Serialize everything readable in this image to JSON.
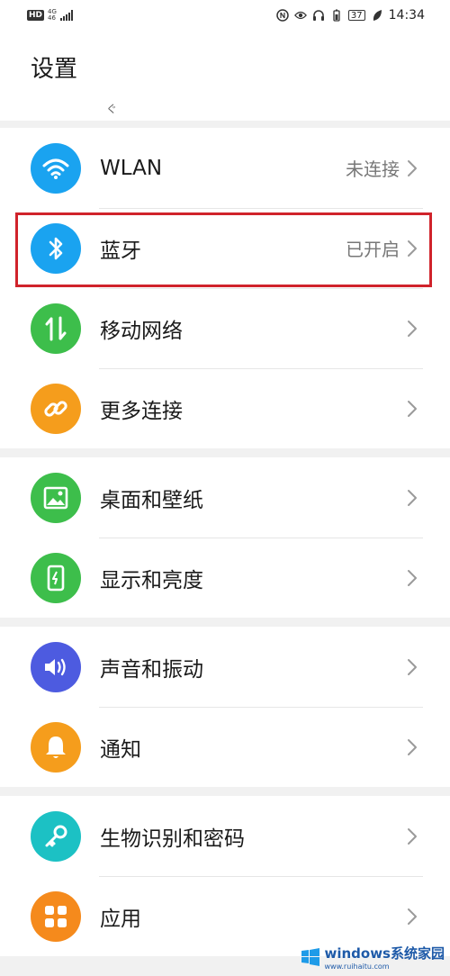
{
  "status_bar": {
    "hd_label": "HD",
    "network_top": "4G",
    "network_bottom": "46",
    "battery_level": "37",
    "time": "14:34",
    "icons": [
      "nfc-icon",
      "eye-icon",
      "headphones-icon",
      "battery-saver-icon",
      "leaf-icon"
    ]
  },
  "header": {
    "title": "设置",
    "scroll_hint": "ぐ"
  },
  "groups": [
    {
      "items": [
        {
          "label": "WLAN",
          "status": "未连接",
          "icon": "wifi-icon",
          "color": "#1aa3f0"
        },
        {
          "label": "蓝牙",
          "status": "已开启",
          "icon": "bluetooth-icon",
          "color": "#1aa3f0"
        },
        {
          "label": "移动网络",
          "status": "",
          "icon": "mobile-data-icon",
          "color": "#3dbe4b"
        },
        {
          "label": "更多连接",
          "status": "",
          "icon": "link-icon",
          "color": "#f59d1c"
        }
      ]
    },
    {
      "items": [
        {
          "label": "桌面和壁纸",
          "status": "",
          "icon": "wallpaper-icon",
          "color": "#3dbe4b"
        },
        {
          "label": "显示和亮度",
          "status": "",
          "icon": "display-icon",
          "color": "#3dbe4b"
        }
      ]
    },
    {
      "items": [
        {
          "label": "声音和振动",
          "status": "",
          "icon": "sound-icon",
          "color": "#4d5be0"
        },
        {
          "label": "通知",
          "status": "",
          "icon": "notification-icon",
          "color": "#f59d1c"
        }
      ]
    },
    {
      "items": [
        {
          "label": "生物识别和密码",
          "status": "",
          "icon": "key-icon",
          "color": "#1cc1c4"
        },
        {
          "label": "应用",
          "status": "",
          "icon": "apps-icon",
          "color": "#f58a1c"
        }
      ]
    }
  ],
  "watermark": {
    "text": "windows系统家园",
    "sub": "www.ruihaitu.com"
  }
}
